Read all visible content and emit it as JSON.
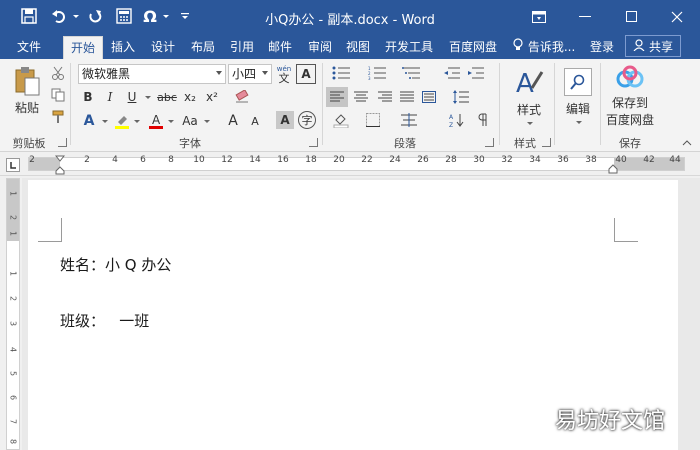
{
  "window": {
    "title": "小Q办公 - 副本.docx - Word"
  },
  "tabs": [
    {
      "label": "文件"
    },
    {
      "label": "开始"
    },
    {
      "label": "插入"
    },
    {
      "label": "设计"
    },
    {
      "label": "布局"
    },
    {
      "label": "引用"
    },
    {
      "label": "邮件"
    },
    {
      "label": "审阅"
    },
    {
      "label": "视图"
    },
    {
      "label": "开发工具"
    },
    {
      "label": "百度网盘"
    }
  ],
  "tab_right": {
    "tell_me": "告诉我...",
    "login": "登录",
    "share": "共享"
  },
  "ribbon": {
    "clipboard": {
      "paste": "粘贴",
      "group": "剪贴板"
    },
    "font": {
      "name": "微软雅黑",
      "size": "小四",
      "wen_top": "wén",
      "wen": "文",
      "bold": "B",
      "italic": "I",
      "underline": "U",
      "strike": "abc",
      "sub": "x₂",
      "sup": "x²",
      "case": "Aa",
      "grow": "A",
      "shrink": "A",
      "shade": "A",
      "phonetic": "字",
      "border": "A",
      "effect": "A",
      "group": "字体"
    },
    "paragraph": {
      "group": "段落"
    },
    "styles": {
      "label": "样式",
      "group": "样式"
    },
    "editing": {
      "label": "编辑"
    },
    "save": {
      "label1": "保存到",
      "label2": "百度网盘",
      "group": "保存"
    }
  },
  "ruler": {
    "ticks": [
      "2",
      "2",
      "4",
      "6",
      "8",
      "10",
      "12",
      "14",
      "16",
      "18",
      "20",
      "22",
      "24",
      "26",
      "28",
      "30",
      "32",
      "34",
      "36",
      "38",
      "40",
      "42",
      "44"
    ],
    "vticks": [
      "1",
      "2",
      "1",
      "1",
      "2",
      "3",
      "4",
      "5",
      "6",
      "7",
      "8"
    ]
  },
  "document": {
    "line1": "姓名：小 Q 办公",
    "line2": "班级：   一班"
  },
  "watermark": "易坊好文馆",
  "colors": {
    "accent": "#2b579a",
    "highlight": "#ffff00",
    "font_color": "#e00000"
  }
}
